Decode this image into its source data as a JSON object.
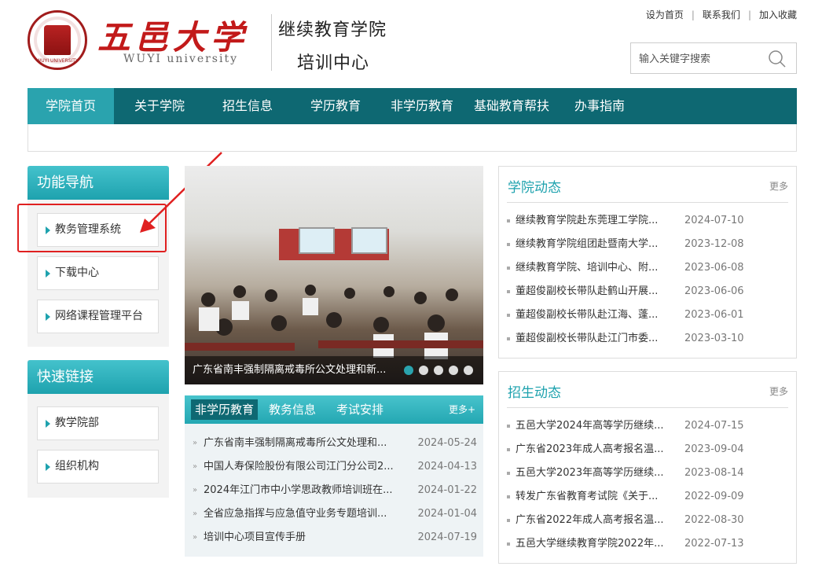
{
  "header": {
    "univ_name": "五邑大学",
    "univ_en": "WUYI university",
    "college": "继续教育学院",
    "center": "培训中心",
    "seal_text": "WUYI UNIVERSITY",
    "top_links": [
      "设为首页",
      "联系我们",
      "加入收藏"
    ],
    "search_placeholder": "输入关键字搜索"
  },
  "nav": {
    "items": [
      "学院首页",
      "关于学院",
      "招生信息",
      "学历教育",
      "非学历教育",
      "基础教育帮扶",
      "办事指南"
    ],
    "active": 0
  },
  "sidebar": {
    "func_title": "功能导航",
    "func_items": [
      "教务管理系统",
      "下载中心",
      "网络课程管理平台"
    ],
    "links_title": "快速链接",
    "link_items": [
      "教学院部",
      "组织机构"
    ]
  },
  "slider": {
    "caption": "广东省南丰强制隔离戒毒所公文处理和新...",
    "dot_count": 5,
    "active_dot": 0
  },
  "tabs": {
    "labels": [
      "非学历教育",
      "教务信息",
      "考试安排"
    ],
    "active": 0,
    "more": "更多+",
    "rows": [
      {
        "title": "广东省南丰强制隔离戒毒所公文处理和...",
        "date": "2024-05-24"
      },
      {
        "title": "中国人寿保险股份有限公司江门分公司2...",
        "date": "2024-04-13"
      },
      {
        "title": "2024年江门市中小学思政教师培训班在...",
        "date": "2024-01-22"
      },
      {
        "title": "全省应急指挥与应急值守业务专题培训...",
        "date": "2024-01-04"
      },
      {
        "title": "培训中心项目宣传手册",
        "date": "2024-07-19"
      }
    ]
  },
  "college_news": {
    "title": "学院动态",
    "more": "更多",
    "rows": [
      {
        "title": "继续教育学院赴东莞理工学院...",
        "date": "2024-07-10"
      },
      {
        "title": "继续教育学院组团赴暨南大学...",
        "date": "2023-12-08"
      },
      {
        "title": "继续教育学院、培训中心、附...",
        "date": "2023-06-08"
      },
      {
        "title": "董超俊副校长带队赴鹤山开展...",
        "date": "2023-06-06"
      },
      {
        "title": "董超俊副校长带队赴江海、蓬...",
        "date": "2023-06-01"
      },
      {
        "title": "董超俊副校长带队赴江门市委...",
        "date": "2023-03-10"
      }
    ]
  },
  "admission_news": {
    "title": "招生动态",
    "more": "更多",
    "rows": [
      {
        "title": "五邑大学2024年高等学历继续...",
        "date": "2024-07-15"
      },
      {
        "title": "广东省2023年成人高考报名温...",
        "date": "2023-09-04"
      },
      {
        "title": "五邑大学2023年高等学历继续...",
        "date": "2023-08-14"
      },
      {
        "title": "转发广东省教育考试院《关于...",
        "date": "2022-09-09"
      },
      {
        "title": "广东省2022年成人高考报名温...",
        "date": "2022-08-30"
      },
      {
        "title": "五邑大学继续教育学院2022年...",
        "date": "2022-07-13"
      }
    ]
  },
  "colors": {
    "nav_bg": "#0e6872",
    "accent": "#2aa3ae",
    "brand_red": "#c21a1a",
    "annotation_red": "#e02020"
  },
  "icons": [
    "search-icon",
    "triangle-right-icon",
    "double-arrow-icon"
  ]
}
